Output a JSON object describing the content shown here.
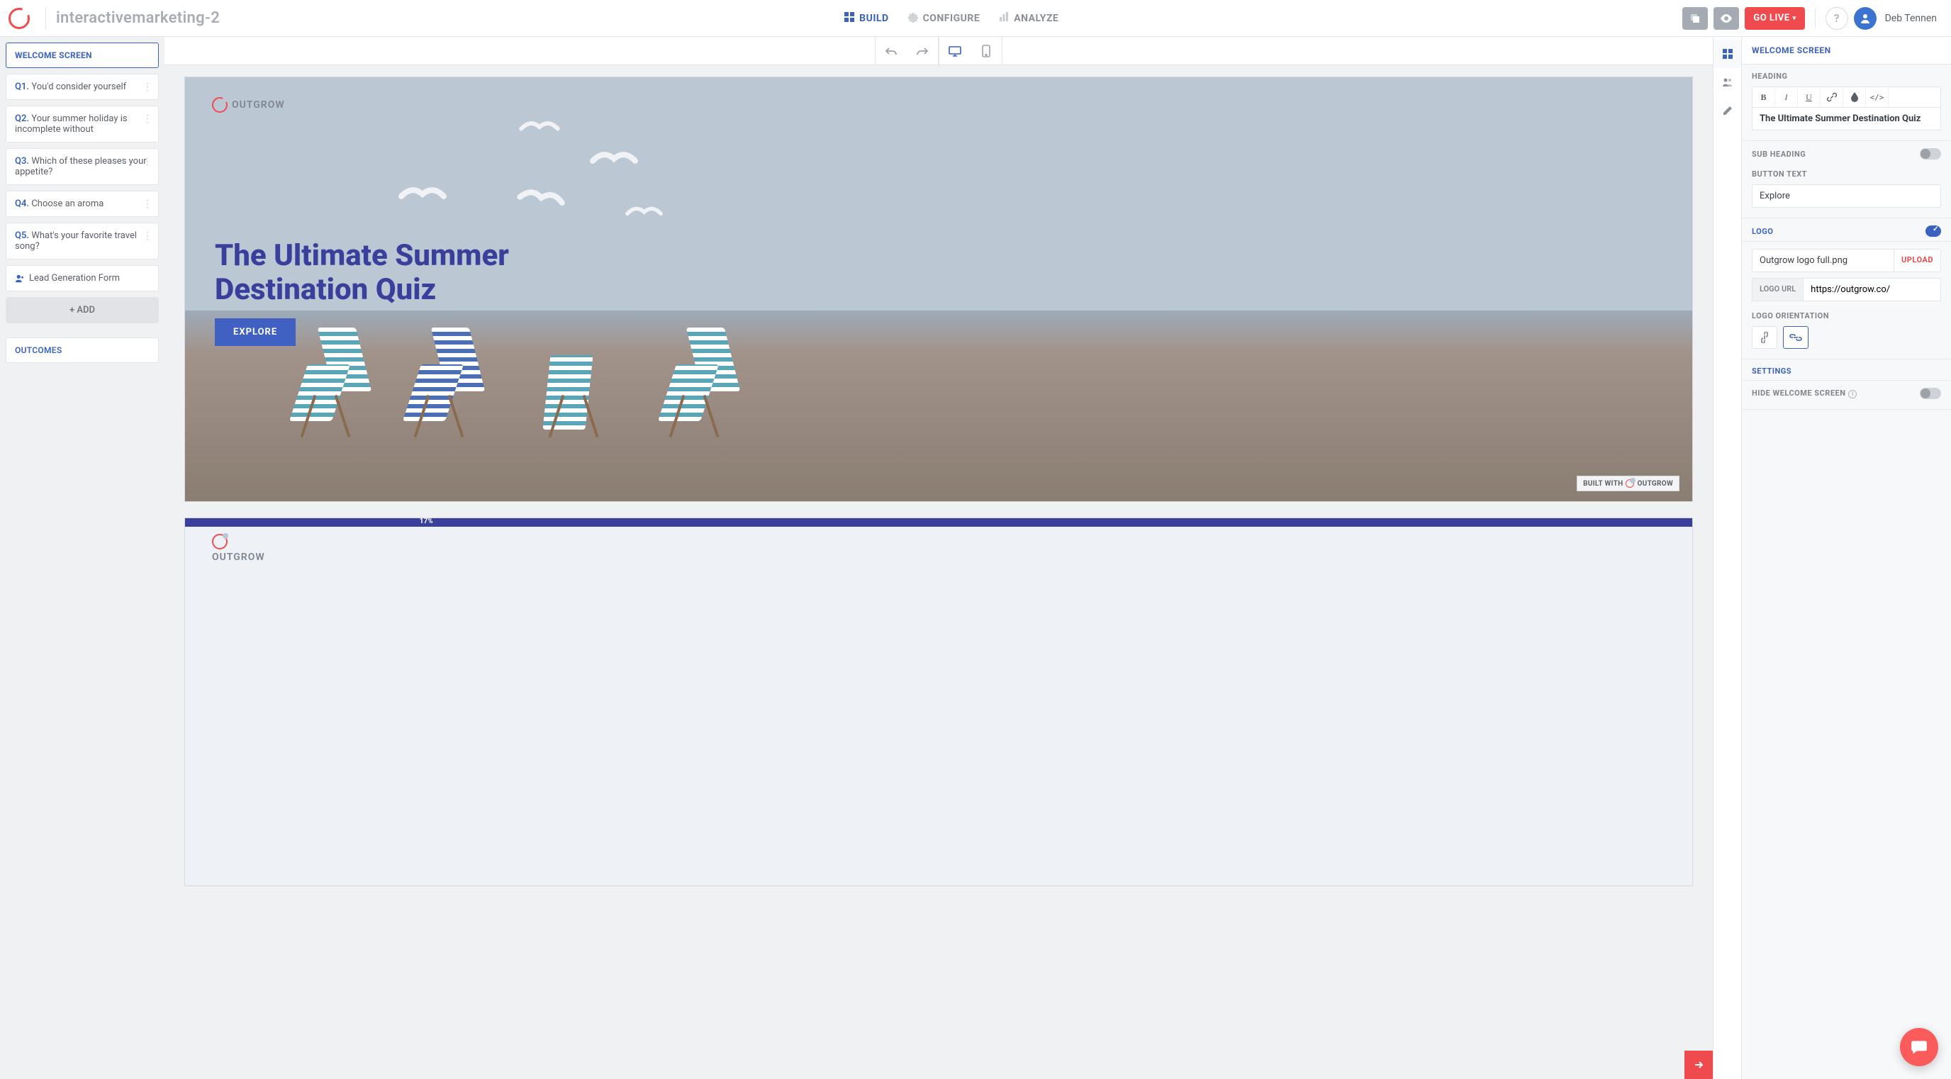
{
  "header": {
    "project_name": "interactivemarketing-2",
    "tabs": {
      "build": "BUILD",
      "configure": "CONFIGURE",
      "analyze": "ANALYZE"
    },
    "golive": "GO LIVE",
    "user": "Deb Tennen"
  },
  "left": {
    "welcome": "WELCOME SCREEN",
    "questions": [
      {
        "num": "Q1.",
        "text": "You'd consider yourself"
      },
      {
        "num": "Q2.",
        "text": "Your summer holiday is incomplete without"
      },
      {
        "num": "Q3.",
        "text": "Which of these pleases your appetite?"
      },
      {
        "num": "Q4.",
        "text": "Choose an aroma"
      },
      {
        "num": "Q5.",
        "text": "What's your favorite travel song?"
      }
    ],
    "lead": "Lead Generation Form",
    "add": "ADD",
    "outcomes": "OUTCOMES"
  },
  "canvas": {
    "brand": "OUTGROW",
    "title": "The Ultimate Summer Destination Quiz",
    "cta": "EXPLORE",
    "built_with": "BUILT WITH",
    "built_brand": "OUTGROW",
    "progress_pct": "17%"
  },
  "right": {
    "panel_title": "WELCOME SCREEN",
    "heading_label": "HEADING",
    "heading_value": "The Ultimate Summer Destination Quiz",
    "subheading_label": "SUB HEADING",
    "button_text_label": "BUTTON TEXT",
    "button_text_value": "Explore",
    "logo_label": "LOGO",
    "logo_filename": "Outgrow logo full.png",
    "upload": "UPLOAD",
    "logo_url_label": "LOGO URL",
    "logo_url_value": "https://outgrow.co/",
    "logo_orientation_label": "LOGO ORIENTATION",
    "settings_label": "SETTINGS",
    "hide_welcome_label": "HIDE WELCOME SCREEN"
  }
}
